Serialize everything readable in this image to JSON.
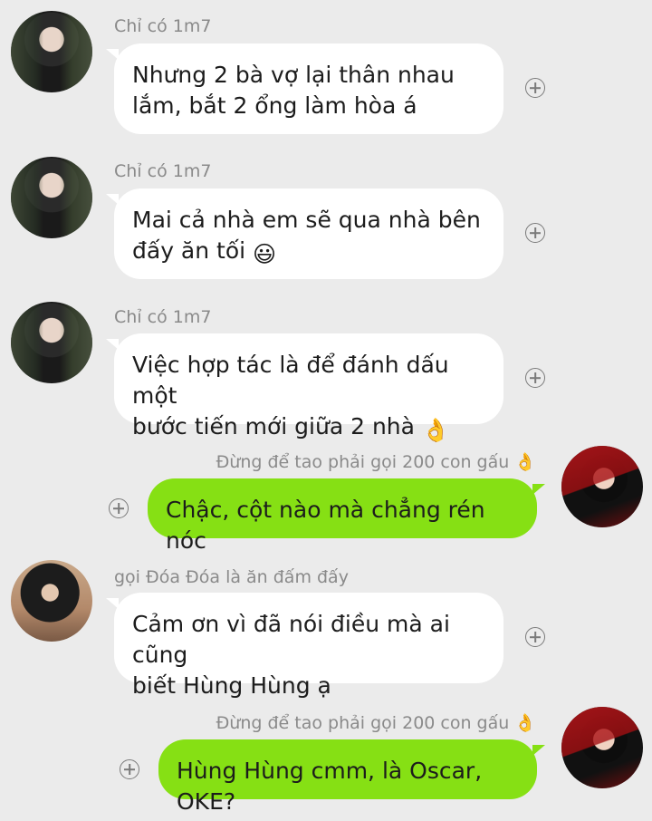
{
  "messages": [
    {
      "sender": "Chỉ có 1m7",
      "line1": "Nhưng 2 bà vợ lại thân nhau",
      "line2": "lắm, bắt 2 ổng làm hòa á",
      "emoji": "",
      "avatar_icon": "avatar-man-black-suit"
    },
    {
      "sender": "Chỉ có 1m7",
      "line1": "Mai cả nhà em sẽ qua nhà bên",
      "line2": "đấy ăn tối",
      "emoji": "😃",
      "avatar_icon": "avatar-man-black-suit"
    },
    {
      "sender": "Chỉ có 1m7",
      "line1": "Việc hợp tác là để đánh dấu một",
      "line2": "bước tiến mới giữa 2 nhà",
      "emoji": "👌",
      "avatar_icon": "avatar-man-black-suit"
    },
    {
      "sender": "Đừng để tao phải gọi 200 con gấu 👌",
      "line1": "Chậc, cột nào mà chẳng rén nóc",
      "line2": "",
      "emoji": "",
      "avatar_icon": "avatar-man-red-background"
    },
    {
      "sender": "gọi Đóa Đóa là ăn đấm đấy",
      "line1": "Cảm ơn vì đã nói điều mà ai cũng",
      "line2": "biết Hùng Hùng ạ",
      "emoji": "",
      "avatar_icon": "avatar-woman-room"
    },
    {
      "sender": "Đừng để tao phải gọi 200 con gấu 👌",
      "line1": "Hùng Hùng cmm, là Oscar, OKE?",
      "line2": "",
      "emoji": "",
      "avatar_icon": "avatar-man-red-background"
    }
  ],
  "colors": {
    "background": "#ebebeb",
    "incoming_bubble": "#ffffff",
    "outgoing_bubble": "#86e014",
    "sender_text": "#8a8a8a"
  }
}
